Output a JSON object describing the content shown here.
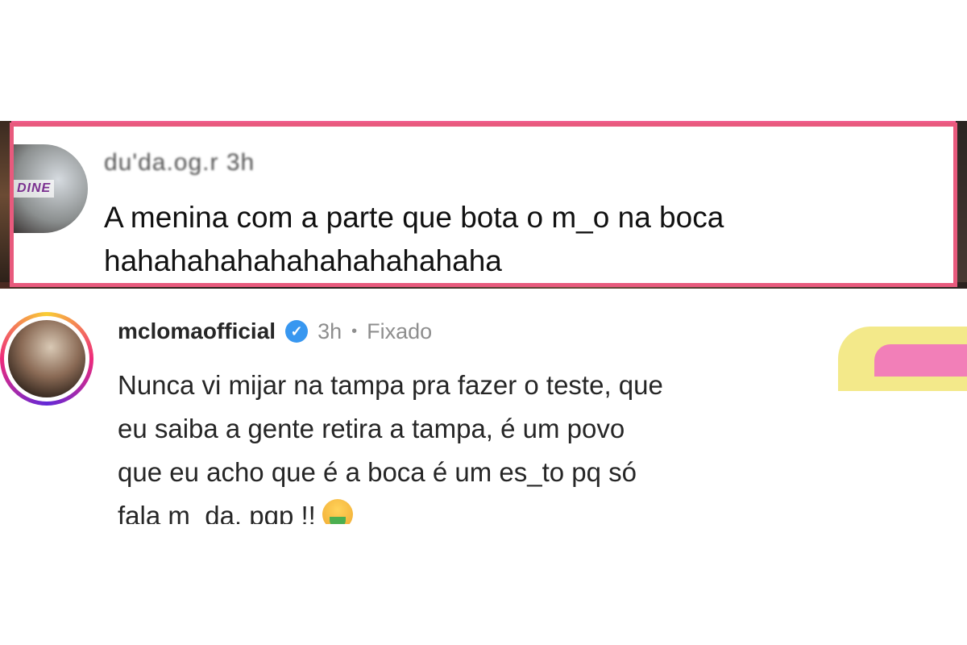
{
  "quoted_comment": {
    "username": "du'da.og.r 3h",
    "avatar_label": "DINE",
    "text_line1": "A menina com a parte que bota o m_o na boca",
    "text_line2": "hahahahahahahahahahahaha"
  },
  "comment": {
    "username": "mcloma​official",
    "time": "3h",
    "separator": "•",
    "pinned_label": "Fixado",
    "text_line1": "Nunca vi mijar na tampa pra fazer o teste, que",
    "text_line2": "eu saiba a gente retira a tampa, é um povo",
    "text_line3": "que eu acho que é a boca é um es_to pq só",
    "text_line4": "fala m_da, pqp !!",
    "emoji": "nauseated-face-emoji",
    "verified_icon": "verified-badge-icon",
    "like_icon": "heart-icon"
  },
  "colors": {
    "border_pink": "#e85a7d",
    "verified_blue": "#3897f0",
    "meta_gray": "#8e8e8e"
  }
}
